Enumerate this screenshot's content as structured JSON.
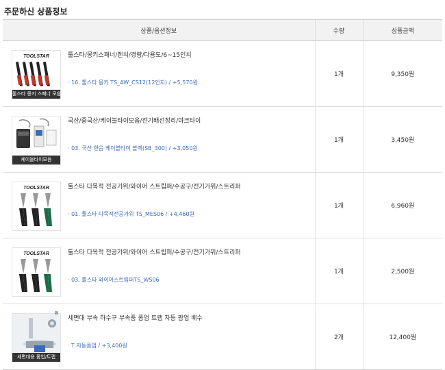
{
  "section_title": "주문하신 상품정보",
  "table": {
    "headers": {
      "product": "상품/옵션정보",
      "qty": "수량",
      "amount": "상품금액"
    },
    "rows": [
      {
        "thumb_caption": "툴스타 몽키 스패너 모음",
        "name": "툴스타/몽키스패너/렌치/경량/다용도/6~15인치",
        "option": "· 16. 툴스타 몽키 TS_AW_CS12(12인치) / +5,570원",
        "qty": "1개",
        "amount": "9,350원"
      },
      {
        "thumb_caption": "케이블타이모음",
        "name": "국산/중국산/케이블타이모음/전기배선정리/마크타이",
        "option": "· 03. 국산 한음 케이블타이 블랙(SB_300) / +3,050원",
        "qty": "1개",
        "amount": "3,450원"
      },
      {
        "thumb_caption": "",
        "name": "툴스타 다목적 전공가위/와이어 스트립퍼/수공구/전기가위/스트리퍼",
        "option": "· 01. 툴스타 다목적전공가위 TS_MES06 / +4,460원",
        "qty": "1개",
        "amount": "6,960원"
      },
      {
        "thumb_caption": "",
        "name": "툴스타 다목적 전공가위/와이어 스트립퍼/수공구/전기가위/스트리퍼",
        "option": "· 03. 툴스타 와이어스트립퍼TS_WS06",
        "qty": "1개",
        "amount": "2,500원"
      },
      {
        "thumb_caption": "세면대용 폼업/트랩",
        "name": "세면대 부속 하수구 부속품 폼업 트랩 자동 팝업 배수",
        "option": "· T 자동폼업 / +3,400원",
        "qty": "2개",
        "amount": "12,400원"
      }
    ]
  },
  "brand_logo": "TOOLSTAR",
  "colors": {
    "option_link": "#3a6ab8",
    "header_bg": "#f2f2f2"
  }
}
